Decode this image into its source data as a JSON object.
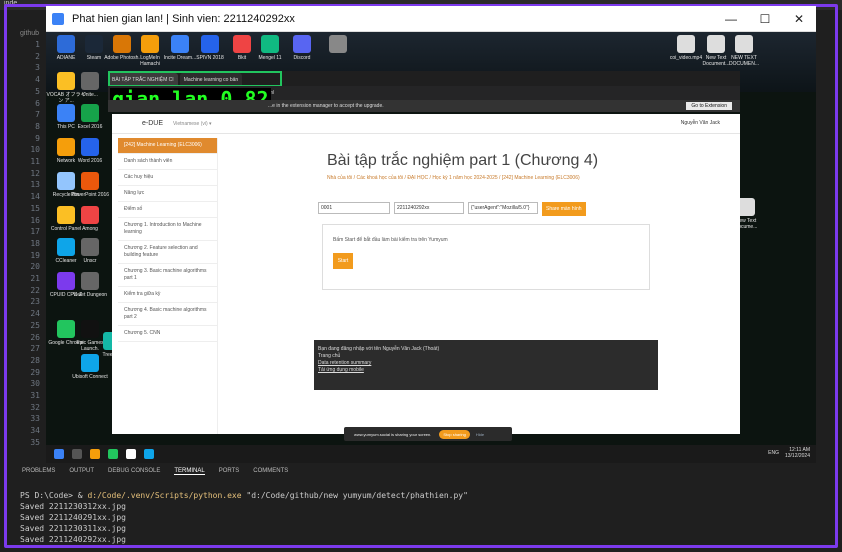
{
  "window": {
    "title": "Phat hien gian lan! | Sinh vien: 2211240292xx",
    "controls": [
      "—",
      "☐",
      "✕"
    ]
  },
  "editor": {
    "top_tab": "inde",
    "explorer_label": "github",
    "line_numbers": [
      "1",
      "2",
      "3",
      "4",
      "5",
      "6",
      "7",
      "8",
      "9",
      "10",
      "11",
      "12",
      "13",
      "14",
      "15",
      "16",
      "17",
      "18",
      "19",
      "20",
      "21",
      "22",
      "23",
      "24",
      "25",
      "26",
      "27",
      "28",
      "29",
      "30",
      "31",
      "32",
      "33",
      "34",
      "35"
    ]
  },
  "desktop_icons": [
    {
      "label": "ADIANE",
      "color": "#2d6bd8"
    },
    {
      "label": "Steam",
      "color": "#1b2838"
    },
    {
      "label": "Adobe Photosh.",
      "color": "#d97706"
    },
    {
      "label": "LogMeIn Hamachi",
      "color": "#f59e0b"
    },
    {
      "label": "Incite Dream...",
      "color": "#3b82f6"
    },
    {
      "label": "SPIVN 2018",
      "color": "#2563eb"
    },
    {
      "label": "Bkit",
      "color": "#ef4444"
    },
    {
      "label": "Mengel 11",
      "color": "#10b981"
    },
    {
      "label": "Discord",
      "color": "#5865f2"
    },
    {
      "label": "",
      "color": "#888"
    },
    {
      "label": "VOCAB オフライン ア...",
      "color": "#fbbf24"
    },
    {
      "label": "Unite...",
      "color": "#666"
    },
    {
      "label": "This PC",
      "color": "#3b82f6"
    },
    {
      "label": "Excel 2016",
      "color": "#16a34a"
    },
    {
      "label": "Network",
      "color": "#f59e0b"
    },
    {
      "label": "Word 2016",
      "color": "#2563eb"
    },
    {
      "label": "Recycle Bin",
      "color": "#93c5fd"
    },
    {
      "label": "PowerPoint 2016",
      "color": "#ea580c"
    },
    {
      "label": "Control Panel",
      "color": "#fbbf24"
    },
    {
      "label": "Among",
      "color": "#ef4444"
    },
    {
      "label": "CCleaner",
      "color": "#0ea5e9"
    },
    {
      "label": "Unscr",
      "color": "#666"
    },
    {
      "label": "CPUID CPU-Z",
      "color": "#7c3aed"
    },
    {
      "label": "Violet Dungeon",
      "color": "#666"
    },
    {
      "label": "Google Chrome",
      "color": "#22c55e"
    },
    {
      "label": "Epic Games Launch.",
      "color": "#111"
    },
    {
      "label": "Treesize",
      "color": "#14b8a6"
    },
    {
      "label": "Ubisoft Connect",
      "color": "#0ea5e9"
    },
    {
      "label": "coi_video.mp4",
      "color": "#ddd"
    },
    {
      "label": "New Text Document...",
      "color": "#ddd"
    },
    {
      "label": "NEW TEXT DOCUMEN...",
      "color": "#ddd"
    },
    {
      "label": "sinh.txt",
      "color": "#ddd"
    },
    {
      "label": "New Text Docume...",
      "color": "#ddd"
    }
  ],
  "browser": {
    "tabs": [
      "BÀI TẬP TRẮC NGHIỆM CI",
      "Machine learning co bản"
    ],
    "url": "...l.html",
    "infobar": "...e in the extension manager to accept the upgrade.",
    "go_extension": "Go to Extension"
  },
  "overlay": {
    "label": "gian lan 0.82",
    "color": "#22ff22"
  },
  "moodle": {
    "logo": "e-DUE",
    "language": "Vietnamese (vi) ▾",
    "user": "Nguyễn Văn Jack",
    "sidebar": [
      "[242] Machine Learning (ELC3006)",
      "Danh sách thành viên",
      "Các huy hiệu",
      "Năng lực",
      "Điểm số",
      "Chương 1. Introduction to Machine learning",
      "Chương 2. Feature selection and building feature",
      "Chương 3. Basic machine algorithms part 1",
      "Kiểm tra giữa kỳ",
      "Chương 4. Basic machine algorithms part 2",
      "Chương 5. CNN"
    ],
    "title": "Bài tập trắc nghiệm part 1 (Chương 4)",
    "breadcrumb": "Nhà của tôi / Các khoá học của tôi / ĐẠI HỌC / Học kỳ 1 năm học 2024-2025 / [242] Machine Learning (ELC3006)",
    "fields": [
      "0001",
      "2211240292xx",
      "{\"userAgent\":\"Mozilla/5.0\"}"
    ],
    "share_button": "Share màn hình",
    "quiz_text": "Bấm Start để bắt đầu làm bài kiểm tra trên Yumyum",
    "start_button": "Start",
    "footer": [
      "Bạn đang đăng nhập với tên Nguyễn Văn Jack (Thoát)",
      "Trang chủ",
      "Data retention summary",
      "Tải ứng dụng mobile"
    ]
  },
  "share_notice": {
    "text": "www.yumyum.social is sharing your screen.",
    "stop": "Stop sharing",
    "hide": "Hide"
  },
  "taskbar": {
    "tray_lang": "ENG",
    "time": "12:11 AM",
    "date": "13/12/2024"
  },
  "panel": {
    "tabs": [
      "PROBLEMS",
      "OUTPUT",
      "DEBUG CONSOLE",
      "TERMINAL",
      "PORTS",
      "COMMENTS"
    ],
    "active": "TERMINAL"
  },
  "terminal": {
    "prompt": "PS D:\\Code> & ",
    "cmd_exe": "d:/Code/.venv/Scripts/python.exe",
    "cmd_arg": " \"d:/Code/github/new yumyum/detect/phathien.py\"",
    "lines": [
      "Saved 2211230312xx.jpg",
      "Saved 2211240291xx.jpg",
      "Saved 2211230311xx.jpg",
      "Saved 2211240292xx.jpg"
    ]
  }
}
